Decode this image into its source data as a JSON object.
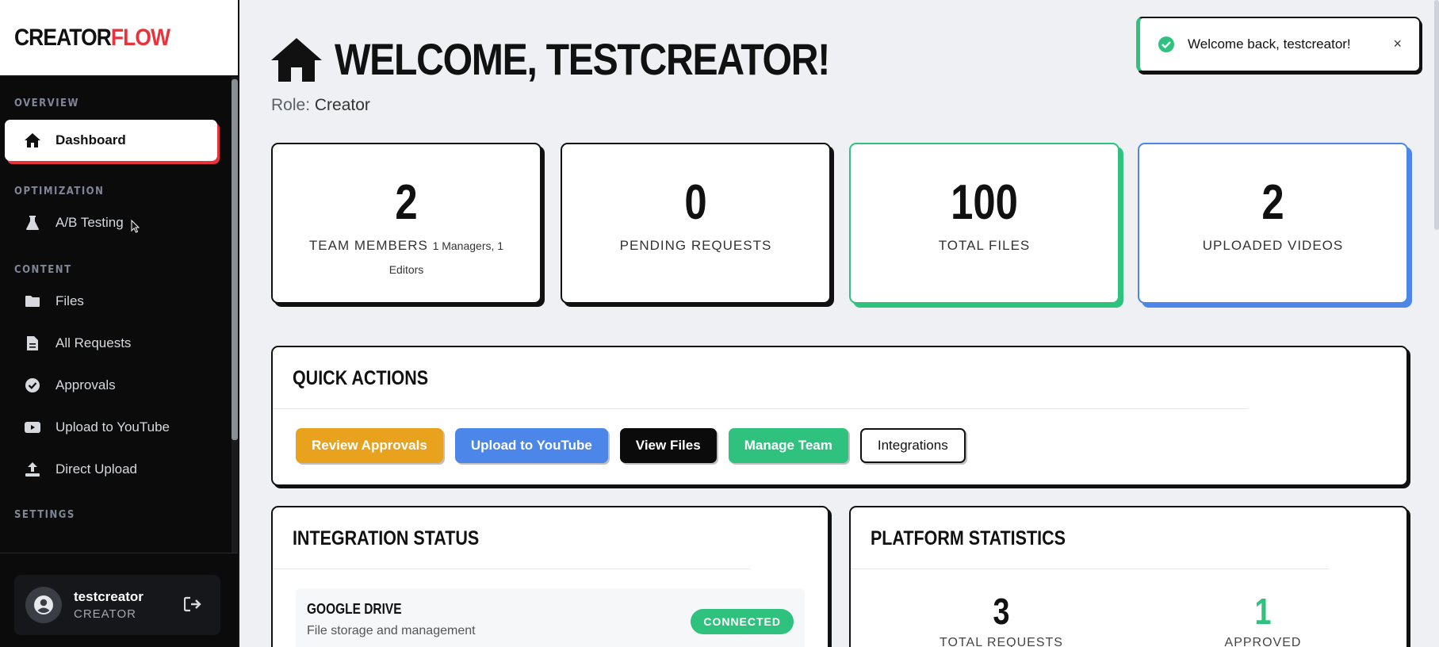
{
  "brand": {
    "part1": "CREATOR",
    "part2": "FLOW"
  },
  "sidebar": {
    "sections": {
      "overview": "OVERVIEW",
      "optimization": "OPTIMIZATION",
      "content": "CONTENT",
      "settings": "SETTINGS"
    },
    "items": {
      "dashboard": "Dashboard",
      "ab_testing": "A/B Testing",
      "files": "Files",
      "all_requests": "All Requests",
      "approvals": "Approvals",
      "upload_youtube": "Upload to YouTube",
      "direct_upload": "Direct Upload"
    },
    "user": {
      "name": "testcreator",
      "role": "CREATOR"
    }
  },
  "header": {
    "title": "WELCOME, TESTCREATOR!",
    "role_label": "Role:",
    "role_value": "Creator"
  },
  "toast": {
    "message": "Welcome back, testcreator!",
    "close": "×"
  },
  "stats": [
    {
      "value": "2",
      "label": "TEAM MEMBERS",
      "sub": "1 Managers, 1 Editors"
    },
    {
      "value": "0",
      "label": "PENDING REQUESTS"
    },
    {
      "value": "100",
      "label": "TOTAL FILES"
    },
    {
      "value": "2",
      "label": "UPLOADED VIDEOS"
    }
  ],
  "quick_actions": {
    "title": "QUICK ACTIONS",
    "buttons": [
      "Review Approvals",
      "Upload to YouTube",
      "View Files",
      "Manage Team",
      "Integrations"
    ]
  },
  "integration_status": {
    "title": "INTEGRATION STATUS",
    "items": [
      {
        "name": "GOOGLE DRIVE",
        "description": "File storage and management",
        "status": "CONNECTED"
      }
    ]
  },
  "platform_statistics": {
    "title": "PLATFORM STATISTICS",
    "stats": [
      {
        "value": "3",
        "label": "TOTAL REQUESTS",
        "color": "#111111"
      },
      {
        "value": "1",
        "label": "APPROVED",
        "color": "#2ec27e"
      }
    ]
  },
  "colors": {
    "accent_red": "#e8333b",
    "green": "#2ec27e",
    "blue": "#4b86e8",
    "orange": "#e8a21d"
  }
}
